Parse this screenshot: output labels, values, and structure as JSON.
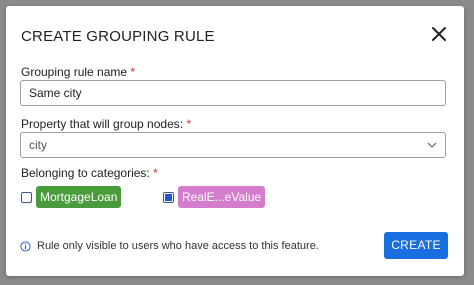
{
  "dialog": {
    "title": "CREATE GROUPING RULE",
    "close_icon": "close-icon"
  },
  "fields": {
    "name": {
      "label": "Grouping rule name",
      "required_mark": "*",
      "value": "Same city"
    },
    "property": {
      "label": "Property that will group nodes:",
      "required_mark": "*",
      "selected": "city",
      "icon": "chevron-down-icon"
    },
    "categories": {
      "label": "Belonging to categories:",
      "required_mark": "*",
      "items": [
        {
          "label": "MortgageLoan",
          "checked": false,
          "color": "#4a9b3c"
        },
        {
          "label": "RealE...eValue",
          "checked": true,
          "color": "#d57dcd"
        }
      ]
    }
  },
  "footer": {
    "info_icon": "info-icon",
    "info_text": "Rule only visible to users who have access to this feature.",
    "create_label": "CREATE"
  },
  "colors": {
    "accent": "#1a6fe0",
    "required": "#d32f2f"
  }
}
